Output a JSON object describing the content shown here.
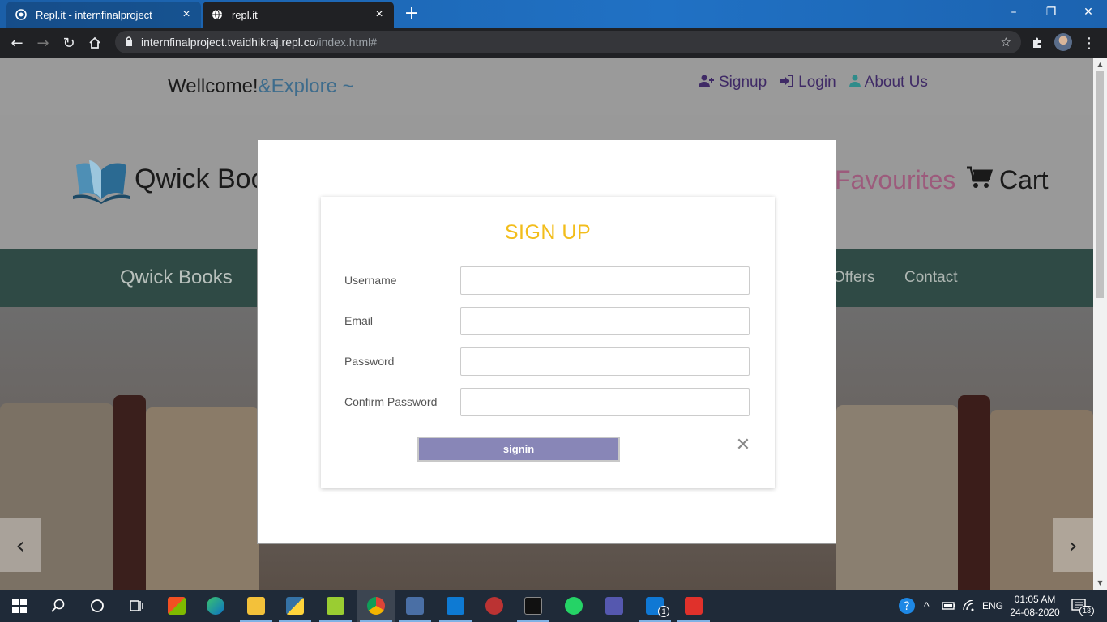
{
  "browser": {
    "tabs": [
      {
        "title": "Repl.it - internfinalproject",
        "icon": "replit-icon"
      },
      {
        "title": "repl.it",
        "icon": "globe-icon"
      }
    ],
    "new_tab": "+",
    "window_controls": {
      "minimize": "–",
      "restore": "❐",
      "close": "✕"
    },
    "address": {
      "host": "internfinalproject.tvaidhikraj.repl.co",
      "path": "/index.html#"
    }
  },
  "site": {
    "welcome": {
      "text": "Wellcome!",
      "accent": "&Explore ~"
    },
    "top_links": [
      {
        "label": "Signup",
        "icon": "user-plus-icon"
      },
      {
        "label": "Login",
        "icon": "sign-in-icon"
      },
      {
        "label": "About Us",
        "icon": "user-icon"
      }
    ],
    "brand": "Qwick Books",
    "favourites": "Favourites",
    "cart": "Cart",
    "nav": {
      "brand": "Qwick Books",
      "items": [
        "Offers",
        "Contact"
      ]
    },
    "carousel": {
      "prev": "‹",
      "next": "›"
    }
  },
  "modal": {
    "title": "SIGN UP",
    "fields": [
      {
        "label": "Username",
        "value": ""
      },
      {
        "label": "Email",
        "value": ""
      },
      {
        "label": "Password",
        "value": ""
      },
      {
        "label": "Confirm Password",
        "value": ""
      }
    ],
    "submit": "signin",
    "close": "✕"
  },
  "taskbar": {
    "apps": [
      "windows-start-icon",
      "search-icon",
      "cortana-icon",
      "task-view-icon",
      "store-icon",
      "edge-icon",
      "file-explorer-icon",
      "python-idle-icon",
      "notepad-plus-icon",
      "chrome-icon",
      "sql-icon",
      "vscode-icon",
      "spider-icon",
      "terminal-icon",
      "whatsapp-icon",
      "teams-icon",
      "mail-icon",
      "git-icon"
    ],
    "language": "ENG",
    "time": "01:05 AM",
    "date": "24-08-2020",
    "notifications": "13",
    "mail_badge": "1"
  },
  "colors": {
    "modal_title": "#f2bd1b",
    "signin_button": "#8886b7",
    "navbar": "#2f4a45",
    "taskbar": "#1f2a38"
  }
}
